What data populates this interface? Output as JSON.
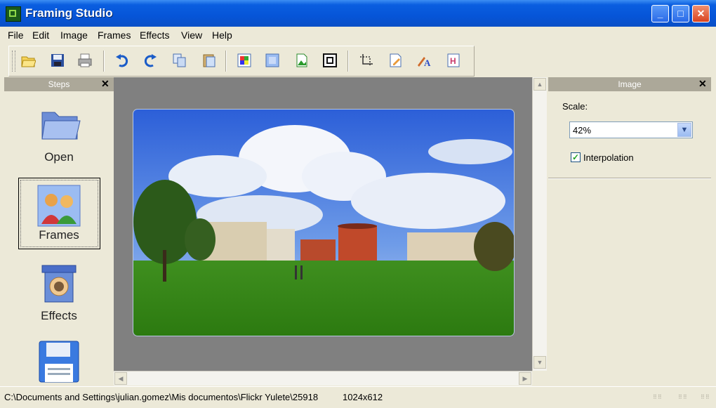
{
  "window": {
    "title": "Framing Studio"
  },
  "menu": [
    "File",
    "Edit",
    "Image",
    "Frames",
    "Effects",
    "View",
    "Help"
  ],
  "toolbar": {
    "buttons": [
      "open-icon",
      "save-icon",
      "print-icon",
      "undo-icon",
      "redo-icon",
      "copy-icon",
      "paste-icon",
      "color-icon",
      "frame-fill-icon",
      "picture-icon",
      "frame-border-icon",
      "crop-icon",
      "edit-icon",
      "text-icon",
      "caption-icon"
    ]
  },
  "steps_panel": {
    "title": "Steps",
    "items": [
      {
        "label": "Open",
        "icon": "folder-icon"
      },
      {
        "label": "Frames",
        "icon": "people-icon",
        "selected": true
      },
      {
        "label": "Effects",
        "icon": "effects-icon"
      },
      {
        "label": "",
        "icon": "floppy-icon"
      }
    ]
  },
  "image_panel": {
    "title": "Image",
    "scale_label": "Scale:",
    "scale_value": "42%",
    "interpolation_label": "Interpolation",
    "interpolation_checked": true
  },
  "status": {
    "path": "C:\\Documents and Settings\\julian.gomez\\Mis documentos\\Flickr Yulete\\25918",
    "size": "1024x612"
  },
  "colors": {
    "titlebar": "#0655d8",
    "canvas": "#808080",
    "panel_header": "#aca899"
  }
}
